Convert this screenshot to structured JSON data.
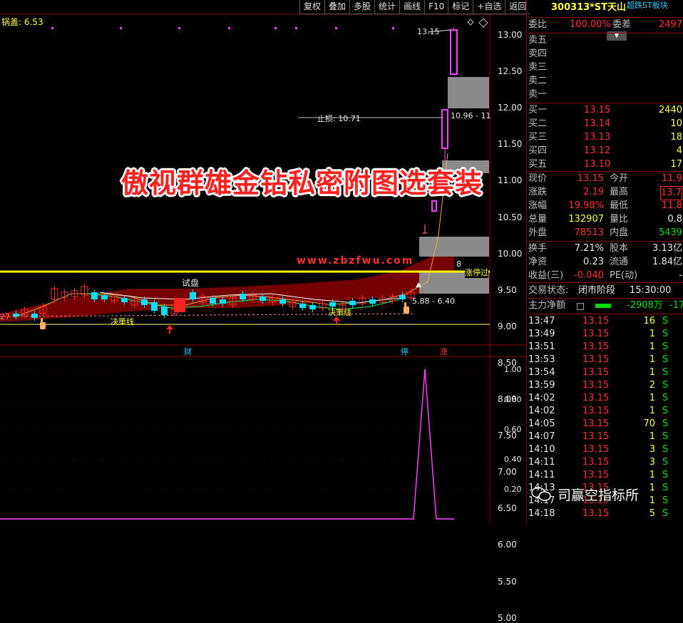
{
  "toolbar": [
    "复权",
    "叠加",
    "多股",
    "统计",
    "画线",
    "F10",
    "标记",
    "+自选",
    "返回"
  ],
  "indicator_label": "锅盖: 6.53",
  "price_axis": [
    "13.00",
    "12.50",
    "12.00",
    "11.50",
    "11.00",
    "10.50",
    "10.00",
    "9.50",
    "9.00",
    "8.50",
    "8.00",
    "7.50",
    "7.00",
    "6.50",
    "6.00",
    "5.50",
    "5.00"
  ],
  "sub_axis": [
    "1.00",
    "0.80",
    "0.60",
    "0.40",
    "0.20"
  ],
  "annotations": {
    "high_label": "13.15",
    "stop_loss": "止损: 10.71",
    "zone_label": "10.96 - 11",
    "range_label": "5.88 - 6.40",
    "limit_line": "涨停过",
    "limit_num": "8",
    "trial": "试盘",
    "decision1": "决策线",
    "decision2": "决策线",
    "left_num": "27",
    "tag_fin": "财",
    "tag_stop": "停",
    "tag_up": "涨"
  },
  "banner": "傲视群雄金钻私密附图选套装",
  "watermark": "www.zbzfwu.com",
  "stock": {
    "code": "300313",
    "name": "*ST天山",
    "block": "超跌ST板块"
  },
  "wei": {
    "label1": "委比",
    "value1": "100.00%",
    "label2": "委差",
    "value2": "2497"
  },
  "asks": [
    {
      "label": "卖五",
      "price": "",
      "vol": ""
    },
    {
      "label": "卖四",
      "price": "",
      "vol": ""
    },
    {
      "label": "卖三",
      "price": "",
      "vol": ""
    },
    {
      "label": "卖二",
      "price": "",
      "vol": ""
    },
    {
      "label": "卖一",
      "price": "",
      "vol": ""
    }
  ],
  "bids": [
    {
      "label": "买一",
      "price": "13.15",
      "vol": "2440"
    },
    {
      "label": "买二",
      "price": "13.14",
      "vol": "10"
    },
    {
      "label": "买三",
      "price": "13.13",
      "vol": "18"
    },
    {
      "label": "买四",
      "price": "13.12",
      "vol": "4"
    },
    {
      "label": "买五",
      "price": "13.10",
      "vol": "17"
    }
  ],
  "quote": [
    {
      "l1": "现价",
      "v1": "13.15",
      "l2": "今开",
      "v2": "11.9"
    },
    {
      "l1": "涨跌",
      "v1": "2.19",
      "l2": "最高",
      "v2": "13.7"
    },
    {
      "l1": "涨幅",
      "v1": "19.98%",
      "l2": "最低",
      "v2": "11.8"
    },
    {
      "l1": "总量",
      "v1": "132907",
      "l2": "量比",
      "v2": "0.8"
    },
    {
      "l1": "外盘",
      "v1": "78513",
      "l2": "内盘",
      "v2": "5439"
    }
  ],
  "quote2": [
    {
      "l1": "换手",
      "v1": "7.21%",
      "l2": "股本",
      "v2": "3.13亿"
    },
    {
      "l1": "净资",
      "v1": "0.23",
      "l2": "流通",
      "v2": "1.84亿"
    },
    {
      "l1": "收益(三)",
      "v1": "-0.040",
      "l2": "PE(动)",
      "v2": "-"
    }
  ],
  "trade_status": {
    "label": "交易状态:",
    "value": "闭市阶段",
    "time": "15:30:00"
  },
  "net_flow": {
    "label": "主力净额",
    "value": "-2908万",
    "extra": "-17"
  },
  "ticks": [
    {
      "t": "13:47",
      "p": "13.15",
      "v": "16",
      "s": "S"
    },
    {
      "t": "13:49",
      "p": "13.15",
      "v": "1",
      "s": "S"
    },
    {
      "t": "13:51",
      "p": "13.15",
      "v": "1",
      "s": "S"
    },
    {
      "t": "13:53",
      "p": "13.15",
      "v": "1",
      "s": "S"
    },
    {
      "t": "13:54",
      "p": "13.15",
      "v": "1",
      "s": "S"
    },
    {
      "t": "13:59",
      "p": "13.15",
      "v": "2",
      "s": "S"
    },
    {
      "t": "14:02",
      "p": "13.15",
      "v": "1",
      "s": "S"
    },
    {
      "t": "14:02",
      "p": "13.15",
      "v": "1",
      "s": "S"
    },
    {
      "t": "14:05",
      "p": "13.15",
      "v": "70",
      "s": "S"
    },
    {
      "t": "14:07",
      "p": "13.15",
      "v": "1",
      "s": "S"
    },
    {
      "t": "14:10",
      "p": "13.15",
      "v": "3",
      "s": "S"
    },
    {
      "t": "14:11",
      "p": "13.15",
      "v": "3",
      "s": "S"
    },
    {
      "t": "14:11",
      "p": "13.15",
      "v": "1",
      "s": "S"
    },
    {
      "t": "14:13",
      "p": "13.15",
      "v": "1",
      "s": "S"
    },
    {
      "t": "14:17",
      "p": "13.15",
      "v": "1",
      "s": "S"
    },
    {
      "t": "14:18",
      "p": "13.15",
      "v": "5",
      "s": "S"
    }
  ],
  "wechat_label": "司赢空指标所",
  "colors": {
    "up": "#ff3030",
    "down": "#00e0ff",
    "limit": "#ffff00",
    "channel": "#7a0000",
    "pink": "#ff40ff"
  }
}
